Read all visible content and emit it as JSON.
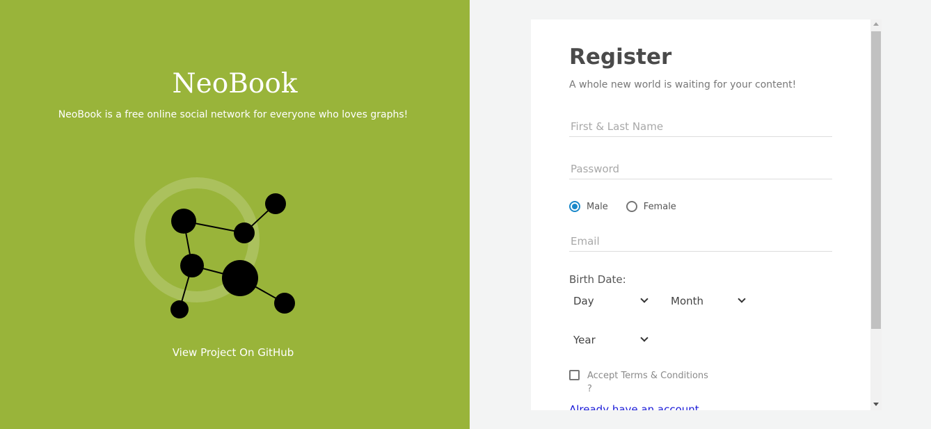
{
  "hero": {
    "brand": "NeoBook",
    "tagline": "NeoBook is a free online social network for everyone who loves graphs!",
    "github_link": "View Project On GitHub",
    "logo_icon": "graph-network-icon"
  },
  "colors": {
    "hero_bg": "#99b43a",
    "accent": "#1a88c9",
    "link": "#1a1ad8"
  },
  "form": {
    "title": "Register",
    "subtitle": "A whole new world is waiting for your content!",
    "name_placeholder": "First & Last Name",
    "password_placeholder": "Password",
    "gender": {
      "options": [
        "Male",
        "Female"
      ],
      "selected": "Male"
    },
    "email_placeholder": "Email",
    "birth_label": "Birth Date:",
    "day_label": "Day",
    "month_label": "Month",
    "year_label": "Year",
    "terms_label": "Accept Terms & Conditions",
    "terms_suffix": "?",
    "terms_checked": false,
    "login_link": "Already have an account"
  }
}
